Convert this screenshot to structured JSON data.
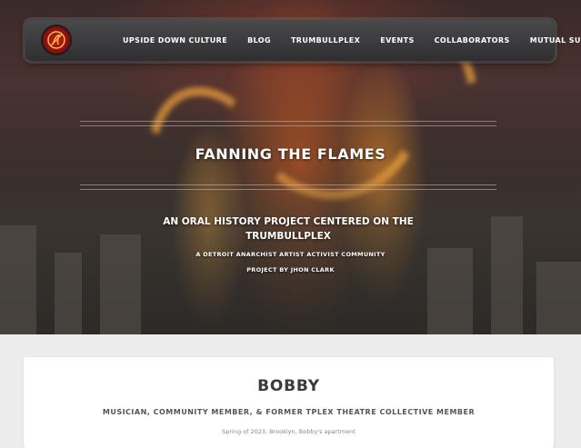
{
  "nav": {
    "logo_icon": "flame-emblem-logo",
    "items": [
      {
        "label": "UPSIDE DOWN CULTURE"
      },
      {
        "label": "BLOG"
      },
      {
        "label": "TRUMBULLPLEX"
      },
      {
        "label": "EVENTS"
      },
      {
        "label": "COLLABORATORS"
      },
      {
        "label": "MUTUAL SUPPORT"
      }
    ]
  },
  "hero": {
    "title": "FANNING THE FLAMES",
    "subtitle": "AN ORAL HISTORY PROJECT CENTERED ON THE TRUMBULLPLEX",
    "tagline": "A DETROIT ANARCHIST ARTIST ACTIVIST COMMUNITY",
    "credit": "PROJECT BY JHON CLARK"
  },
  "profile": {
    "name": "BOBBY",
    "role": "MUSICIAN, COMMUNITY MEMBER, & FORMER TPLEX THEATRE COLLECTIVE MEMBER",
    "meta": "Spring of 2023, Brooklyn, Bobby's apartment"
  },
  "colors": {
    "accent_red": "#c21d1d",
    "nav_bg": "#3a3a3d",
    "page_bg": "#ececec"
  }
}
